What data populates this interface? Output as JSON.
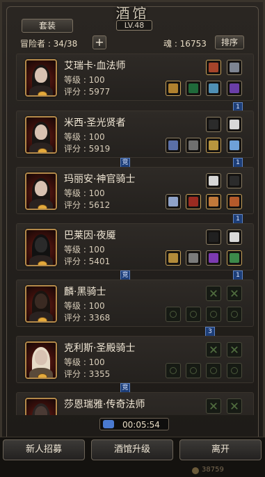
{
  "header": {
    "title": "酒馆",
    "level": "LV.48",
    "suit_label": "套装",
    "adventurer_label": "冒险者 : 34/38",
    "add_label": "+",
    "soul_label": "魂 : 16753",
    "sort_label": "排序"
  },
  "heroes": [
    {
      "name": "艾瑞卡·血法师",
      "level": "等级 : 100",
      "score": "评分 : 5977"
    },
    {
      "name": "米西·圣光贤者",
      "level": "等级 : 100",
      "score": "评分 : 5919"
    },
    {
      "name": "玛丽安·神官骑士",
      "level": "等级 : 100",
      "score": "评分 : 5612"
    },
    {
      "name": "巴莱因·夜魇",
      "level": "等级 : 100",
      "score": "评分 : 5401"
    },
    {
      "name": "麟·黑骑士",
      "level": "等级 : 100",
      "score": "评分 : 3368"
    },
    {
      "name": "克利斯·圣殿骑士",
      "level": "等级 : 100",
      "score": "评分 : 3355"
    },
    {
      "name": "莎恩瑞雅·传奇法师",
      "level": "",
      "score": ""
    }
  ],
  "flags": {
    "one": "1",
    "three": "3",
    "duel": "竞"
  },
  "timer": "00:05:54",
  "bottom": {
    "recruit": "新人招募",
    "upgrade": "酒馆升级",
    "leave": "离开",
    "coin_value": "38759"
  }
}
